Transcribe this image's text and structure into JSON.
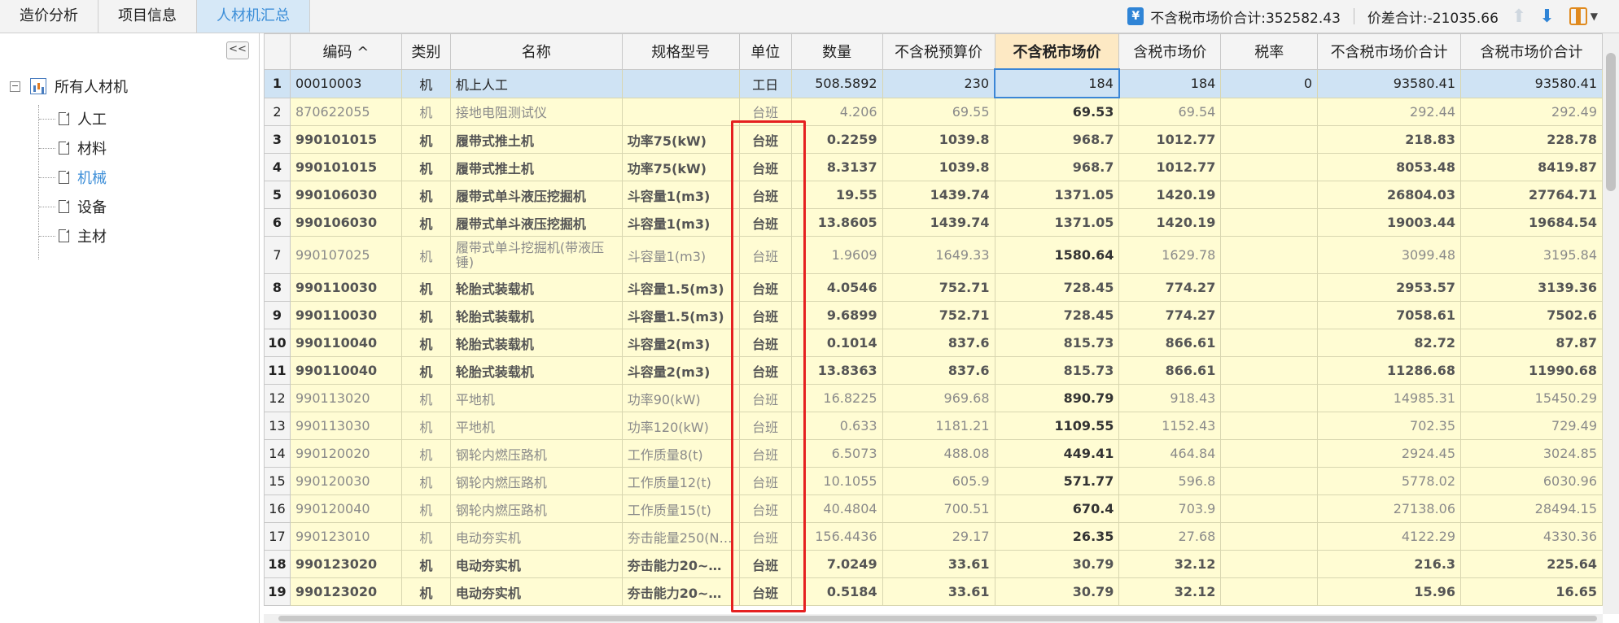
{
  "tabs": [
    {
      "label": "造价分析"
    },
    {
      "label": "项目信息"
    },
    {
      "label": "人材机汇总"
    }
  ],
  "summary": {
    "market_total_label": "不含税市场价合计:352582.43",
    "diff_total_label": "价差合计:-21035.66"
  },
  "sidebar": {
    "collapse_label": "<<",
    "root": "所有人材机",
    "items": [
      {
        "label": "人工"
      },
      {
        "label": "材料"
      },
      {
        "label": "机械"
      },
      {
        "label": "设备"
      },
      {
        "label": "主材"
      }
    ]
  },
  "table": {
    "headers": [
      "编码 ^",
      "类别",
      "名称",
      "规格型号",
      "单位",
      "数量",
      "不含税预算价",
      "不含税市场价",
      "含税市场价",
      "税率",
      "不含税市场价合计",
      "含税市场价合计"
    ],
    "rows": [
      {
        "n": "1",
        "code": "00010003",
        "cat": "机",
        "name": "机上人工",
        "spec": "",
        "unit": "工日",
        "qty": "508.5892",
        "budget": "230",
        "market": "184",
        "taxmarket": "184",
        "rate": "0",
        "total": "93580.41",
        "taxtotal": "93580.41"
      },
      {
        "n": "2",
        "code": "870622055",
        "cat": "机",
        "name": "接地电阻测试仪",
        "spec": "",
        "unit": "台班",
        "qty": "4.206",
        "budget": "69.55",
        "market": "69.53",
        "taxmarket": "69.54",
        "rate": "",
        "total": "292.44",
        "taxtotal": "292.49"
      },
      {
        "n": "3",
        "code": "990101015",
        "cat": "机",
        "name": "履带式推土机",
        "spec": "功率75(kW)",
        "unit": "台班",
        "qty": "0.2259",
        "budget": "1039.8",
        "market": "968.7",
        "taxmarket": "1012.77",
        "rate": "",
        "total": "218.83",
        "taxtotal": "228.78"
      },
      {
        "n": "4",
        "code": "990101015",
        "cat": "机",
        "name": "履带式推土机",
        "spec": "功率75(kW)",
        "unit": "台班",
        "qty": "8.3137",
        "budget": "1039.8",
        "market": "968.7",
        "taxmarket": "1012.77",
        "rate": "",
        "total": "8053.48",
        "taxtotal": "8419.87"
      },
      {
        "n": "5",
        "code": "990106030",
        "cat": "机",
        "name": "履带式单斗液压挖掘机",
        "spec": "斗容量1(m3)",
        "unit": "台班",
        "qty": "19.55",
        "budget": "1439.74",
        "market": "1371.05",
        "taxmarket": "1420.19",
        "rate": "",
        "total": "26804.03",
        "taxtotal": "27764.71"
      },
      {
        "n": "6",
        "code": "990106030",
        "cat": "机",
        "name": "履带式单斗液压挖掘机",
        "spec": "斗容量1(m3)",
        "unit": "台班",
        "qty": "13.8605",
        "budget": "1439.74",
        "market": "1371.05",
        "taxmarket": "1420.19",
        "rate": "",
        "total": "19003.44",
        "taxtotal": "19684.54"
      },
      {
        "n": "7",
        "code": "990107025",
        "cat": "机",
        "name": "履带式单斗挖掘机(带液压锤)",
        "spec": "斗容量1(m3)",
        "unit": "台班",
        "qty": "1.9609",
        "budget": "1649.33",
        "market": "1580.64",
        "taxmarket": "1629.78",
        "rate": "",
        "total": "3099.48",
        "taxtotal": "3195.84"
      },
      {
        "n": "8",
        "code": "990110030",
        "cat": "机",
        "name": "轮胎式装载机",
        "spec": "斗容量1.5(m3)",
        "unit": "台班",
        "qty": "4.0546",
        "budget": "752.71",
        "market": "728.45",
        "taxmarket": "774.27",
        "rate": "",
        "total": "2953.57",
        "taxtotal": "3139.36"
      },
      {
        "n": "9",
        "code": "990110030",
        "cat": "机",
        "name": "轮胎式装载机",
        "spec": "斗容量1.5(m3)",
        "unit": "台班",
        "qty": "9.6899",
        "budget": "752.71",
        "market": "728.45",
        "taxmarket": "774.27",
        "rate": "",
        "total": "7058.61",
        "taxtotal": "7502.6"
      },
      {
        "n": "10",
        "code": "990110040",
        "cat": "机",
        "name": "轮胎式装载机",
        "spec": "斗容量2(m3)",
        "unit": "台班",
        "qty": "0.1014",
        "budget": "837.6",
        "market": "815.73",
        "taxmarket": "866.61",
        "rate": "",
        "total": "82.72",
        "taxtotal": "87.87"
      },
      {
        "n": "11",
        "code": "990110040",
        "cat": "机",
        "name": "轮胎式装载机",
        "spec": "斗容量2(m3)",
        "unit": "台班",
        "qty": "13.8363",
        "budget": "837.6",
        "market": "815.73",
        "taxmarket": "866.61",
        "rate": "",
        "total": "11286.68",
        "taxtotal": "11990.68"
      },
      {
        "n": "12",
        "code": "990113020",
        "cat": "机",
        "name": "平地机",
        "spec": "功率90(kW)",
        "unit": "台班",
        "qty": "16.8225",
        "budget": "969.68",
        "market": "890.79",
        "taxmarket": "918.43",
        "rate": "",
        "total": "14985.31",
        "taxtotal": "15450.29"
      },
      {
        "n": "13",
        "code": "990113030",
        "cat": "机",
        "name": "平地机",
        "spec": "功率120(kW)",
        "unit": "台班",
        "qty": "0.633",
        "budget": "1181.21",
        "market": "1109.55",
        "taxmarket": "1152.43",
        "rate": "",
        "total": "702.35",
        "taxtotal": "729.49"
      },
      {
        "n": "14",
        "code": "990120020",
        "cat": "机",
        "name": "钢轮内燃压路机",
        "spec": "工作质量8(t)",
        "unit": "台班",
        "qty": "6.5073",
        "budget": "488.08",
        "market": "449.41",
        "taxmarket": "464.84",
        "rate": "",
        "total": "2924.45",
        "taxtotal": "3024.85"
      },
      {
        "n": "15",
        "code": "990120030",
        "cat": "机",
        "name": "钢轮内燃压路机",
        "spec": "工作质量12(t)",
        "unit": "台班",
        "qty": "10.1055",
        "budget": "605.9",
        "market": "571.77",
        "taxmarket": "596.8",
        "rate": "",
        "total": "5778.02",
        "taxtotal": "6030.96"
      },
      {
        "n": "16",
        "code": "990120040",
        "cat": "机",
        "name": "钢轮内燃压路机",
        "spec": "工作质量15(t)",
        "unit": "台班",
        "qty": "40.4804",
        "budget": "700.51",
        "market": "670.4",
        "taxmarket": "703.9",
        "rate": "",
        "total": "27138.06",
        "taxtotal": "28494.15"
      },
      {
        "n": "17",
        "code": "990123010",
        "cat": "机",
        "name": "电动夯实机",
        "spec": "夯击能量250(N…",
        "unit": "台班",
        "qty": "156.4436",
        "budget": "29.17",
        "market": "26.35",
        "taxmarket": "27.68",
        "rate": "",
        "total": "4122.29",
        "taxtotal": "4330.36"
      },
      {
        "n": "18",
        "code": "990123020",
        "cat": "机",
        "name": "电动夯实机",
        "spec": "夯击能力20~…",
        "unit": "台班",
        "qty": "7.0249",
        "budget": "33.61",
        "market": "30.79",
        "taxmarket": "32.12",
        "rate": "",
        "total": "216.3",
        "taxtotal": "225.64"
      },
      {
        "n": "19",
        "code": "990123020",
        "cat": "机",
        "name": "电动夯实机",
        "spec": "夯击能力20~…",
        "unit": "台班",
        "qty": "0.5184",
        "budget": "33.61",
        "market": "30.79",
        "taxmarket": "32.12",
        "rate": "",
        "total": "15.96",
        "taxtotal": "16.65"
      }
    ]
  }
}
